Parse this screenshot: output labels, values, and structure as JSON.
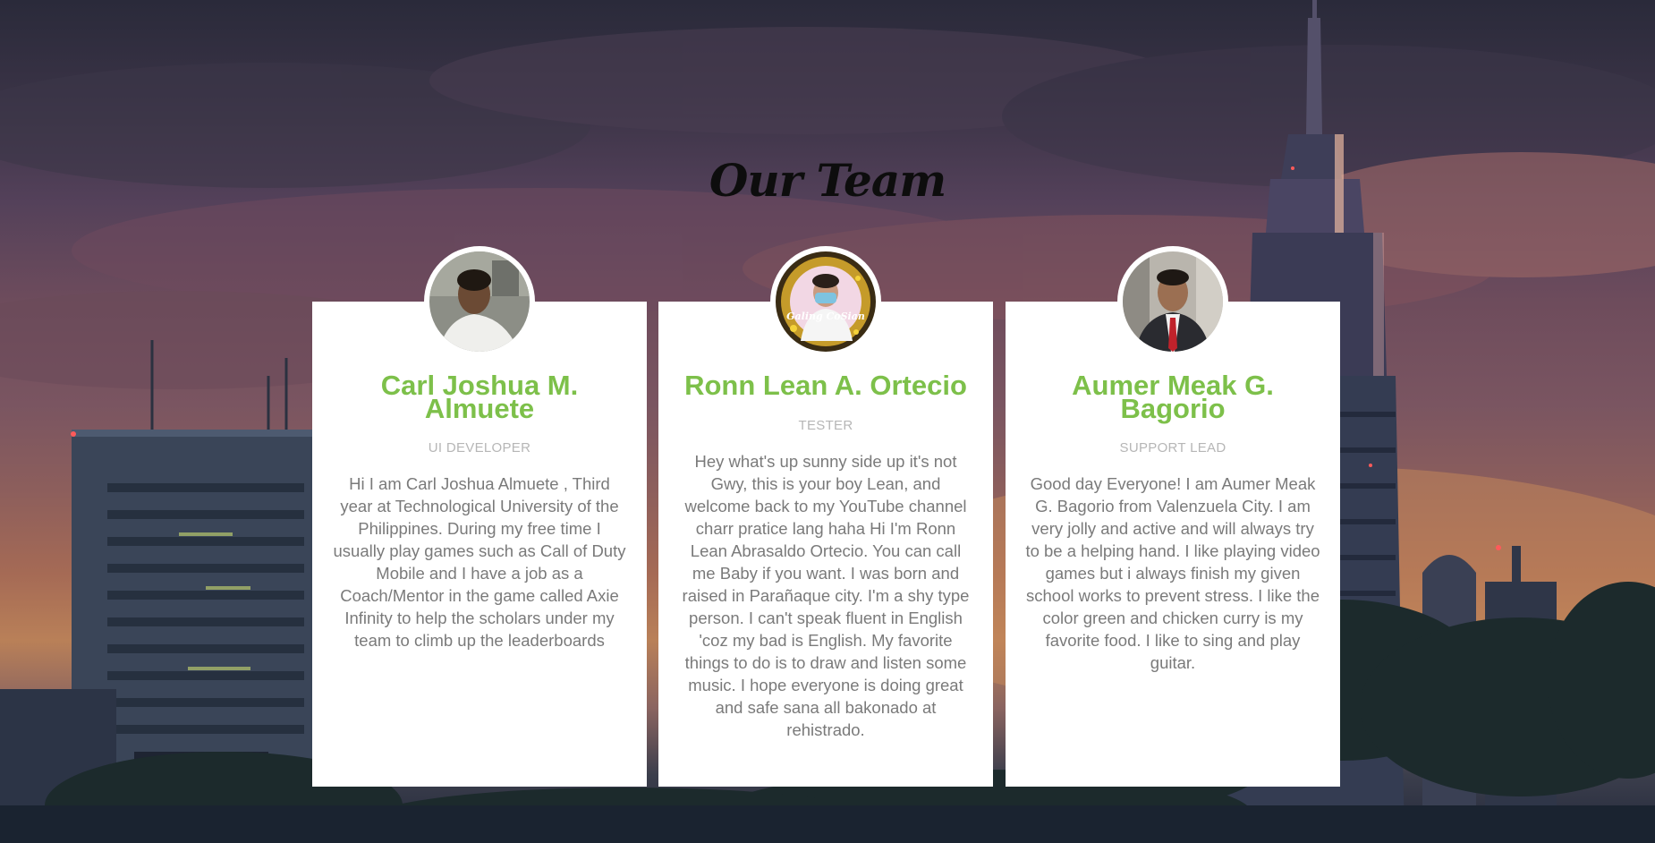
{
  "page": {
    "title": "Our Team",
    "colors": {
      "name_green": "#7dc04a",
      "role_gray": "#b6b6b6",
      "bio_gray": "#7a7a7a",
      "card_bg": "#ffffff"
    }
  },
  "team": [
    {
      "name": "Carl Joshua M. Almuete",
      "role": "UI DEVELOPER",
      "bio": "Hi I am Carl Joshua Almuete , Third year at Technological University of the Philippines. During my free time I usually play games such as Call of Duty Mobile and I have a job as a Coach/Mentor in the game called Axie Infinity to help the scholars under my team to climb up the leaderboards",
      "avatar_icon": "person-photo-icon"
    },
    {
      "name": "Ronn Lean A. Ortecio",
      "role": "TESTER",
      "bio": "Hey what's up sunny side up it's not Gwy, this is your boy Lean, and welcome back to my YouTube channel charr pratice lang haha Hi I'm Ronn Lean Abrasaldo Ortecio. You can call me Baby if you want. I was born and raised in Parañaque city. I'm a shy type person. I can't speak fluent in English 'coz my bad is English. My favorite things to do is to draw and listen some music. I hope everyone is doing great and safe sana all bakonado at rehistrado.",
      "avatar_icon": "person-photo-icon",
      "avatar_badge_text": "Galing CoSian"
    },
    {
      "name": "Aumer Meak G. Bagorio",
      "role": "SUPPORT LEAD",
      "bio": "Good day Everyone! I am Aumer Meak G. Bagorio from Valenzuela City. I am very jolly and active and will always try to be a helping hand. I like playing video games but i always finish my given school works to prevent stress. I like the color green and chicken curry is my favorite food. I like to sing and play guitar.",
      "avatar_icon": "person-photo-icon"
    }
  ]
}
